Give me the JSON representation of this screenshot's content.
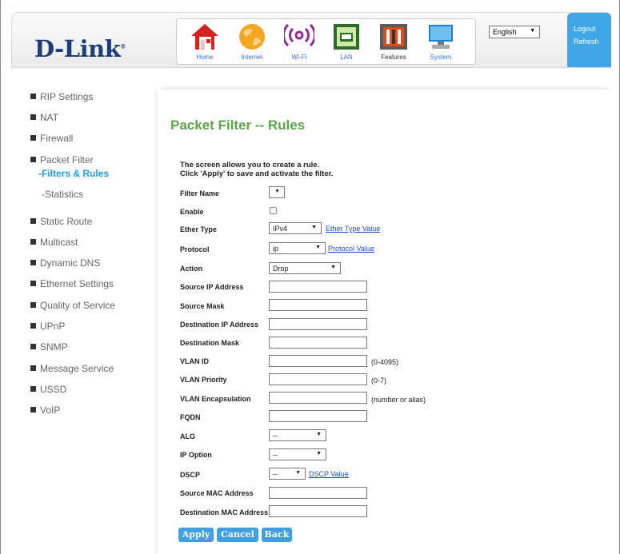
{
  "header": {
    "logo": "D-Link",
    "nav": [
      {
        "label": "Home",
        "icon": "home-icon"
      },
      {
        "label": "Internet",
        "icon": "globe-icon"
      },
      {
        "label": "Wi-Fi",
        "icon": "wifi-icon"
      },
      {
        "label": "LAN",
        "icon": "lan-icon"
      },
      {
        "label": "Features",
        "icon": "toolbox-icon"
      },
      {
        "label": "System",
        "icon": "computer-icon"
      }
    ],
    "language": "English",
    "logout": "Logout",
    "refresh": "Refresh"
  },
  "sidebar": {
    "items": [
      "RIP Settings",
      "NAT",
      "Firewall",
      "Packet Filter",
      "Static Route",
      "Multicast",
      "Dynamic DNS",
      "Ethernet Settings",
      "Quality of Service",
      "UPnP",
      "SNMP",
      "Message Service",
      "USSD",
      "VoIP"
    ],
    "subitems": [
      "-Filters & Rules",
      "-Statistics"
    ]
  },
  "main": {
    "title": "Packet Filter -- Rules",
    "intro_line1": "The screen allows you to create a rule.",
    "intro_line2": "Click 'Apply' to save and activate the filter.",
    "fields": {
      "filter_name": "Filter Name",
      "enable": "Enable",
      "ether_type": "Ether Type",
      "ether_type_value": "IPv4",
      "ether_type_link": "Ether Type Value",
      "protocol": "Protocol",
      "protocol_value": "ip",
      "protocol_link": "Protocol Value",
      "action": "Action",
      "action_value": "Drop",
      "source_ip": "Source IP Address",
      "source_mask": "Source Mask",
      "dest_ip": "Destination IP Address",
      "dest_mask": "Destination Mask",
      "vlan_id": "VLAN ID",
      "vlan_id_hint": "(0-4095)",
      "vlan_priority": "VLAN Priority",
      "vlan_priority_hint": "(0-7)",
      "vlan_encap": "VLAN Encapsulation",
      "vlan_encap_hint": "(number or alias)",
      "fqdn": "FQDN",
      "alg": "ALG",
      "alg_value": "--",
      "ip_option": "IP Option",
      "ip_option_value": "--",
      "dscp": "DSCP",
      "dscp_value": "--",
      "dscp_link": "DSCP Value",
      "source_mac": "Source MAC Address",
      "dest_mac": "Destination MAC Address"
    },
    "buttons": {
      "apply": "Apply",
      "cancel": "Cancel",
      "back": "Back"
    }
  },
  "colors": {
    "accent": "#3fa6e8",
    "title": "#5da54b",
    "link": "#1a4fc7",
    "logo": "#1d3e7b"
  }
}
